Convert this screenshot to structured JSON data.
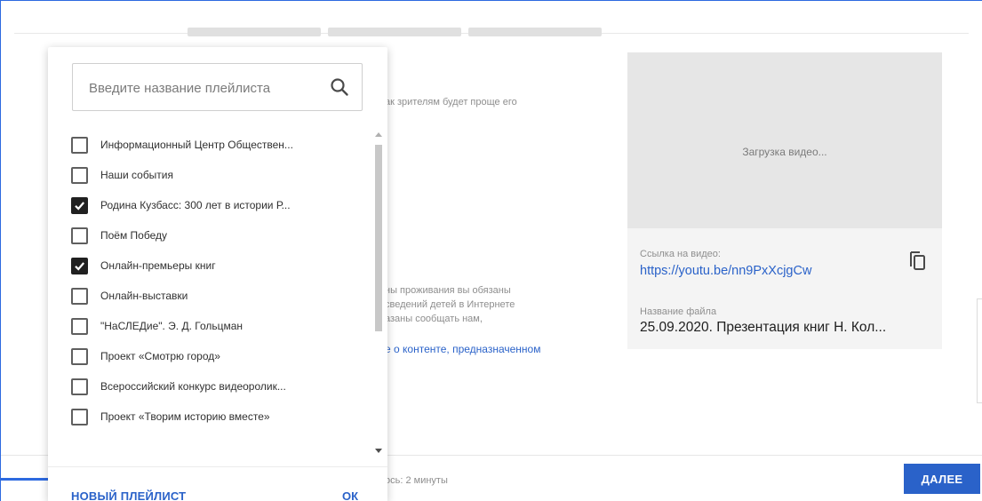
{
  "background": {
    "description_hint": "ак зрителям будет проще его",
    "notice_lines": [
      "ны проживания вы обязаны",
      "сведений детей в Интернете",
      "азаны сообщать нам,"
    ],
    "notice_link": "е о контенте, предназначенном",
    "bottom_status": "ось: 2 минуты",
    "next_label": "ДАЛЕЕ"
  },
  "preview": {
    "loading_text": "Загрузка видео...",
    "link_label": "Ссылка на видео:",
    "link_url": "https://youtu.be/nn9PxXcjgCw",
    "filename_label": "Название файла",
    "filename": "25.09.2020. Презентация книг Н. Кол..."
  },
  "playlist_dropdown": {
    "search_placeholder": "Введите название плейлиста",
    "items": [
      {
        "label": "Информационный Центр Обществен...",
        "checked": false
      },
      {
        "label": "Наши события",
        "checked": false
      },
      {
        "label": "Родина Кузбасс: 300 лет в истории Р...",
        "checked": true
      },
      {
        "label": "Поём Победу",
        "checked": false
      },
      {
        "label": "Онлайн-премьеры книг",
        "checked": true
      },
      {
        "label": "Онлайн-выставки",
        "checked": false
      },
      {
        "label": "\"НаСЛЕДие\". Э. Д. Гольцман",
        "checked": false
      },
      {
        "label": "Проект «Смотрю город»",
        "checked": false
      },
      {
        "label": "Всероссийский конкурс видеоролик...",
        "checked": false
      },
      {
        "label": "Проект «Творим историю вместе»",
        "checked": false
      }
    ],
    "new_playlist_label": "НОВЫЙ ПЛЕЙЛИСТ",
    "ok_label": "ОК"
  },
  "colors": {
    "accent": "#2a62c9",
    "checkbox_checked": "#202020"
  }
}
